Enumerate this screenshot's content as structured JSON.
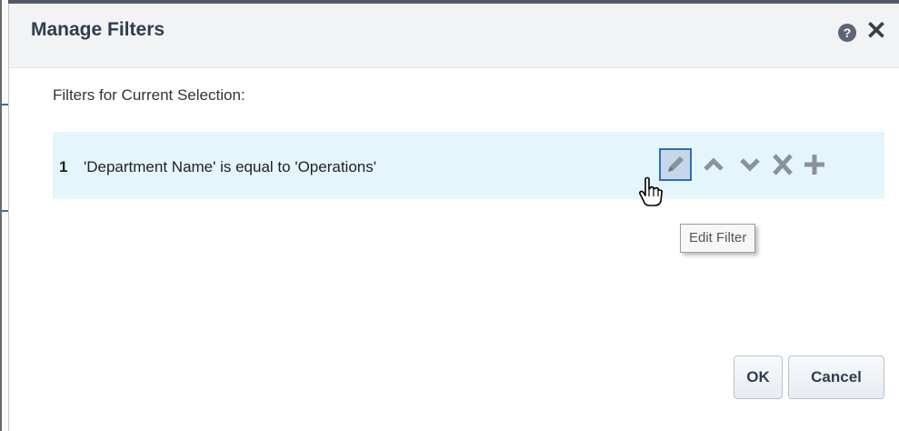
{
  "dialog": {
    "title": "Manage Filters",
    "help_icon": "help-circle-icon",
    "close_icon": "close-icon",
    "subtitle": "Filters for Current Selection:",
    "filters": [
      {
        "number": "1",
        "text": "'Department Name' is equal to 'Operations'"
      }
    ],
    "actions": [
      "edit-pencil-icon",
      "move-up-icon",
      "move-down-icon",
      "delete-icon",
      "add-icon"
    ],
    "tooltip": "Edit Filter",
    "buttons": {
      "ok": "OK",
      "cancel": "Cancel"
    },
    "colors": {
      "row_bg": "#e4f6fc",
      "icon": "#8a939c",
      "edit_active": "#2e6fb0",
      "title": "#2f3d4c"
    }
  }
}
